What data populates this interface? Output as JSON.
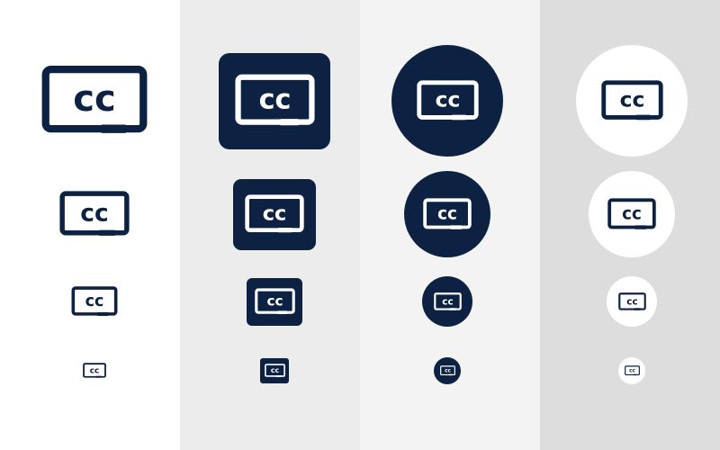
{
  "brand": {
    "navy": "#0d2242",
    "white": "#ffffff"
  },
  "panel_colors": [
    "#ffffff",
    "#ececec",
    "#f3f3f3",
    "#dddddd"
  ],
  "icon_glyph": "cc",
  "icon_name": "closed-captions-icon",
  "variants": [
    "plain",
    "rounded-square",
    "circle",
    "white-circle"
  ]
}
